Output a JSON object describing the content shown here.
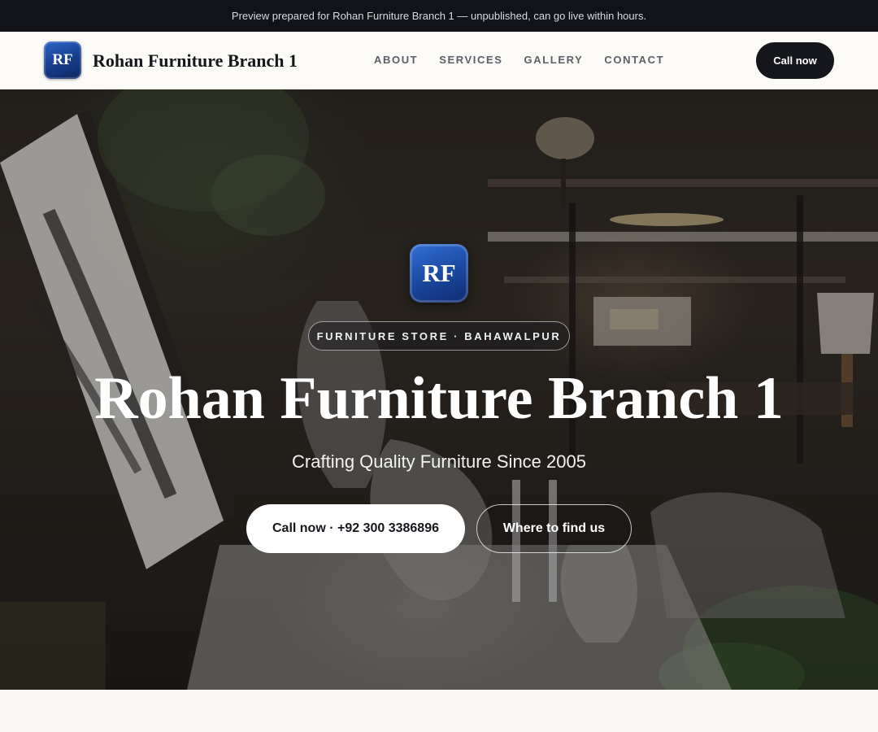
{
  "preview_banner": {
    "text": "Preview prepared for Rohan Furniture Branch 1 — unpublished, can go live within hours."
  },
  "header": {
    "logo_text": "RF",
    "brand_name": "Rohan Furniture Branch 1",
    "nav": [
      {
        "label": "ABOUT"
      },
      {
        "label": "SERVICES"
      },
      {
        "label": "GALLERY"
      },
      {
        "label": "CONTACT"
      }
    ],
    "cta_label": "Call now"
  },
  "hero": {
    "logo_text": "RF",
    "tag": "FURNITURE STORE · BAHAWALPUR",
    "title": "Rohan Furniture Branch 1",
    "subtitle": "Crafting Quality Furniture Since 2005",
    "primary_button": "Call now · +92 300 3386896",
    "secondary_button": "Where to find us"
  },
  "colors": {
    "dark": "#15171c",
    "brand_blue": "#1b4aa3",
    "page_bg": "#faf9f6"
  }
}
